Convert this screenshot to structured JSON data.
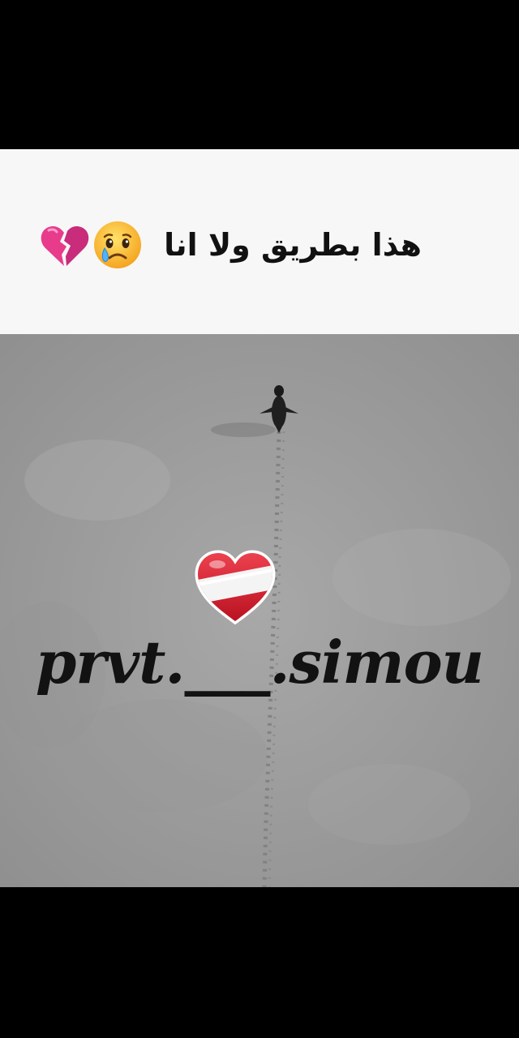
{
  "caption": {
    "text": "هذا بطريق ولا انا",
    "emojis": [
      "crying-face-emoji",
      "broken-heart-emoji"
    ]
  },
  "video": {
    "watermark": "prvt.___.simou",
    "subject": "penguin",
    "sticker": "red-white-striped-heart-emoji"
  },
  "colors": {
    "letterbox": "#000000",
    "caption_background": "#f7f7f7",
    "caption_text": "#111111",
    "ground": "#9f9f9f",
    "watermark_text": "#121212",
    "heart_red": "#d91c2c",
    "broken_heart_pink": "#e83b8c"
  }
}
